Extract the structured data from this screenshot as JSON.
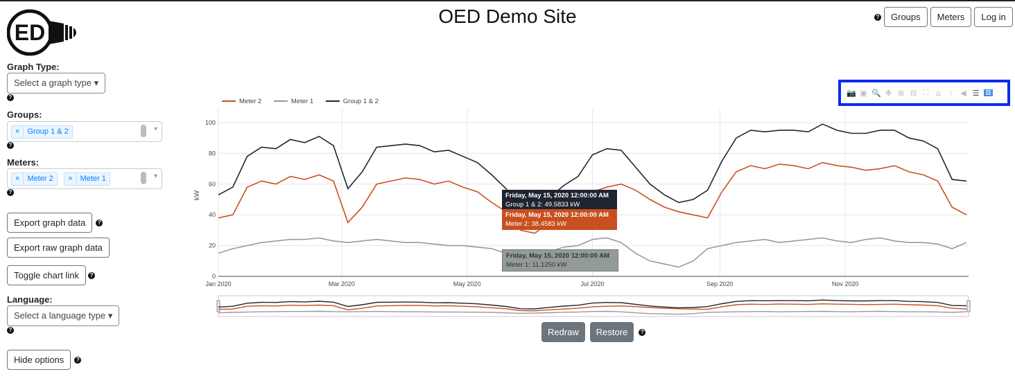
{
  "header": {
    "title": "OED Demo Site",
    "buttons": [
      "Groups",
      "Meters",
      "Log in"
    ],
    "logo_text": "ED"
  },
  "sidebar": {
    "graph_type_label": "Graph Type:",
    "graph_type_value": "Select a graph type",
    "groups_label": "Groups:",
    "groups_selected": [
      "Group 1 & 2"
    ],
    "meters_label": "Meters:",
    "meters_selected": [
      "Meter 2",
      "Meter 1"
    ],
    "export_graph": "Export graph data",
    "export_raw": "Export raw graph data",
    "toggle_link": "Toggle chart link",
    "language_label": "Language:",
    "language_value": "Select a language type",
    "hide_options": "Hide options"
  },
  "controls": {
    "redraw": "Redraw",
    "restore": "Restore"
  },
  "modebar_icons": [
    "camera-icon",
    "save-icon",
    "zoom-icon",
    "pan-icon",
    "zoom-in-icon",
    "zoom-out-icon",
    "autoscale-icon",
    "reset-axes-icon",
    "spike-lines-icon",
    "hover-closest-icon",
    "hover-compare-icon",
    "plotly-logo-icon"
  ],
  "tooltips": [
    {
      "title": "Friday, May 15, 2020 12:00:00 AM",
      "text": "Group 1 & 2: 49.5833 kW",
      "color": "#1e2530"
    },
    {
      "title": "Friday, May 15, 2020 12:00:00 AM",
      "text": "Meter 2: 38.4583 kW",
      "color": "#c8501e"
    },
    {
      "title": "Friday, May 15, 2020 12:00:00 AM",
      "text": "Meter 1: 11.1250 kW",
      "color": "#939a9a"
    }
  ],
  "chart_data": {
    "type": "line",
    "ylabel": "kW",
    "ylim": [
      0,
      105
    ],
    "grid": true,
    "legend_position": "top-left",
    "yticks": [
      "0",
      "20",
      "40",
      "60",
      "80",
      "100"
    ],
    "xticks": [
      "Jan 2020",
      "Mar 2020",
      "May 2020",
      "Jul 2020",
      "Sep 2020",
      "Nov 2020"
    ],
    "x": [
      "2020-01-01",
      "2020-01-08",
      "2020-01-15",
      "2020-01-22",
      "2020-01-29",
      "2020-02-05",
      "2020-02-12",
      "2020-02-19",
      "2020-02-26",
      "2020-03-04",
      "2020-03-11",
      "2020-03-18",
      "2020-03-25",
      "2020-04-01",
      "2020-04-08",
      "2020-04-15",
      "2020-04-22",
      "2020-04-29",
      "2020-05-06",
      "2020-05-13",
      "2020-05-20",
      "2020-05-27",
      "2020-06-03",
      "2020-06-10",
      "2020-06-17",
      "2020-06-24",
      "2020-07-01",
      "2020-07-08",
      "2020-07-15",
      "2020-07-22",
      "2020-07-29",
      "2020-08-05",
      "2020-08-12",
      "2020-08-19",
      "2020-08-26",
      "2020-09-02",
      "2020-09-09",
      "2020-09-16",
      "2020-09-23",
      "2020-09-30",
      "2020-10-07",
      "2020-10-14",
      "2020-10-21",
      "2020-10-28",
      "2020-11-04",
      "2020-11-11",
      "2020-11-18",
      "2020-11-25",
      "2020-12-02",
      "2020-12-09",
      "2020-12-16",
      "2020-12-23",
      "2020-12-30"
    ],
    "series": [
      {
        "name": "Meter 2",
        "color": "#c8501e",
        "values": [
          38,
          40,
          58,
          62,
          60,
          65,
          63,
          66,
          62,
          35,
          45,
          60,
          62,
          64,
          63,
          60,
          62,
          58,
          55,
          48,
          42,
          30,
          28,
          35,
          40,
          45,
          55,
          58,
          60,
          56,
          50,
          45,
          42,
          40,
          38,
          55,
          68,
          72,
          70,
          73,
          72,
          70,
          74,
          72,
          71,
          69,
          70,
          72,
          68,
          66,
          62,
          45,
          40
        ]
      },
      {
        "name": "Meter 1",
        "color": "#999999",
        "values": [
          15,
          18,
          20,
          22,
          23,
          24,
          24,
          25,
          23,
          22,
          23,
          24,
          23,
          22,
          22,
          21,
          20,
          20,
          19,
          18,
          15,
          12,
          13,
          16,
          19,
          20,
          24,
          25,
          22,
          15,
          10,
          8,
          6,
          10,
          18,
          20,
          22,
          23,
          24,
          22,
          23,
          24,
          25,
          23,
          22,
          24,
          25,
          23,
          22,
          22,
          21,
          18,
          22
        ]
      },
      {
        "name": "Group 1 & 2",
        "color": "#1e2530",
        "values": [
          53,
          58,
          78,
          84,
          83,
          89,
          87,
          91,
          85,
          57,
          68,
          84,
          85,
          86,
          85,
          81,
          82,
          78,
          74,
          66,
          57,
          42,
          41,
          51,
          59,
          65,
          79,
          83,
          82,
          71,
          60,
          53,
          48,
          50,
          56,
          75,
          90,
          95,
          94,
          95,
          95,
          94,
          99,
          95,
          93,
          93,
          95,
          95,
          90,
          88,
          83,
          63,
          62
        ]
      }
    ]
  }
}
